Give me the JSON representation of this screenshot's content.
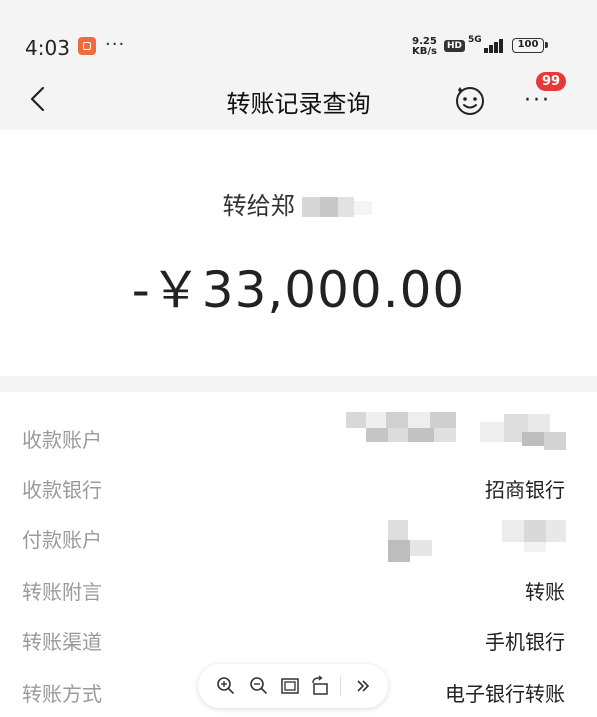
{
  "status_bar": {
    "time": "4:03",
    "more": "···",
    "net_speed_value": "9.25",
    "net_speed_unit": "KB/s",
    "hd": "HD",
    "network": "5G",
    "battery": "100"
  },
  "navbar": {
    "title": "转账记录查询",
    "more": "···",
    "badge": "99"
  },
  "summary": {
    "recipient_prefix": "转给郑",
    "amount": "-￥33,000.00"
  },
  "details": {
    "rows": [
      {
        "label": "收款账户",
        "value": ""
      },
      {
        "label": "收款银行",
        "value": "招商银行"
      },
      {
        "label": "付款账户",
        "value": ""
      },
      {
        "label": "转账附言",
        "value": "转账"
      },
      {
        "label": "转账渠道",
        "value": "手机银行"
      },
      {
        "label": "转账方式",
        "value": "电子银行转账"
      }
    ]
  },
  "toolbar": {
    "icons": [
      "zoom-in-icon",
      "zoom-out-icon",
      "fit-screen-icon",
      "rotate-icon",
      "next-icon"
    ]
  },
  "colors": {
    "badge_red": "#e8393a",
    "app_orange": "#ef6a3c",
    "label_gray": "#9a9a9a",
    "page_bg": "#f4f4f4"
  }
}
